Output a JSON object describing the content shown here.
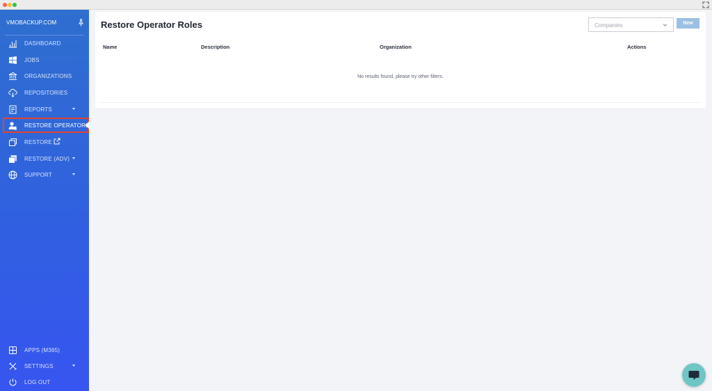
{
  "sidebar": {
    "brand": "VMOBACKUP.COM",
    "items": [
      {
        "label": "DASHBOARD",
        "icon": "bar-chart-icon"
      },
      {
        "label": "JOBS",
        "icon": "windows-icon"
      },
      {
        "label": "ORGANIZATIONS",
        "icon": "bank-icon"
      },
      {
        "label": "REPOSITORIES",
        "icon": "cloud-download-icon"
      },
      {
        "label": "REPORTS",
        "icon": "report-icon"
      },
      {
        "label": "RESTORE OPERATORS",
        "icon": "users-icon"
      },
      {
        "label": "RESTORE",
        "icon": "restore-icon"
      },
      {
        "label": "RESTORE (ADV)",
        "icon": "restore-adv-icon"
      },
      {
        "label": "SUPPORT",
        "icon": "globe-icon"
      }
    ],
    "bottom_items": [
      {
        "label": "APPS (M365)",
        "icon": "grid-icon"
      },
      {
        "label": "SETTINGS",
        "icon": "tools-icon"
      },
      {
        "label": "LOG OUT",
        "icon": "power-icon"
      }
    ]
  },
  "main": {
    "title": "Restore Operator Roles",
    "companies_placeholder": "Companies",
    "new_label": "New",
    "columns": [
      "Name",
      "Description",
      "Organization",
      "Actions"
    ],
    "empty_message": "No results found, please try other filters."
  },
  "colors": {
    "sidebar_top": "#2f6fcf",
    "sidebar_bottom": "#3755f0",
    "active_outline": "#e2452f",
    "new_button": "#9cc0e2",
    "chat_bubble": "#6fc6c4"
  }
}
